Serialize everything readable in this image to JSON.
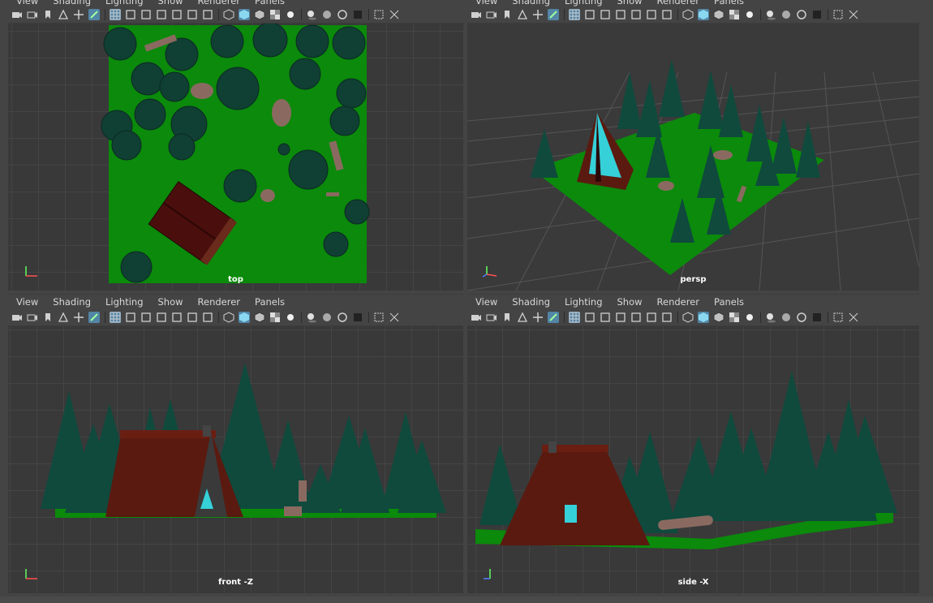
{
  "menus": [
    "View",
    "Shading",
    "Lighting",
    "Show",
    "Renderer",
    "Panels"
  ],
  "toolbar_icons": [
    "camera-select-icon",
    "camera-attributes-icon",
    "bookmark-icon",
    "image-plane-icon",
    "two-d-pan-icon",
    "grease-pencil-icon",
    "grid-icon",
    "film-gate-icon",
    "resolution-gate-icon",
    "gate-mask-icon",
    "field-chart-icon",
    "safe-action-icon",
    "safe-title-icon",
    "wireframe-icon",
    "smooth-shade-icon",
    "wireframe-on-shaded-icon",
    "textured-icon",
    "use-all-lights-icon",
    "shadows-icon",
    "ambient-occlusion-icon",
    "motion-blur-icon",
    "anti-aliasing-icon",
    "isolate-select-icon",
    "xray-icon"
  ],
  "panels": {
    "top": {
      "label": "top"
    },
    "persp": {
      "label": "persp"
    },
    "front": {
      "label": "front -Z"
    },
    "side": {
      "label": "side -X"
    }
  },
  "colors": {
    "ground": "#0b8a0b",
    "tree": "#0f4a3d",
    "cabin": "#5a1a10",
    "window": "#35d0d8",
    "grid_bg": "#393939",
    "grid_line": "#4e4e4e",
    "selected_tool": "#5285a6"
  }
}
